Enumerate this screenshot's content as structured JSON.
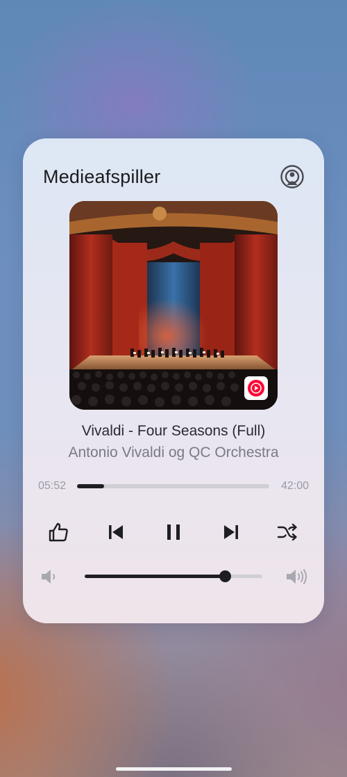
{
  "player": {
    "title": "Medieafspiller",
    "track_title": "Vivaldi - Four Seasons (Full)",
    "track_artist": "Antonio Vivaldi og QC Orchestra",
    "time_elapsed": "05:52",
    "time_total": "42:00",
    "progress_fraction": 0.14,
    "volume_fraction": 0.79,
    "artwork_description_icon": "concert-hall-artwork",
    "source_app_icon": "youtube-music-icon"
  },
  "controls": [
    {
      "name": "like-button",
      "icon": "thumbs-up-icon"
    },
    {
      "name": "previous-button",
      "icon": "skip-previous-icon"
    },
    {
      "name": "pause-button",
      "icon": "pause-icon"
    },
    {
      "name": "next-button",
      "icon": "skip-next-icon"
    },
    {
      "name": "shuffle-button",
      "icon": "shuffle-icon"
    }
  ],
  "colors": {
    "accent": "#1e1e22",
    "track": "#cfcfd6",
    "youtube_red": "#ff0033"
  }
}
